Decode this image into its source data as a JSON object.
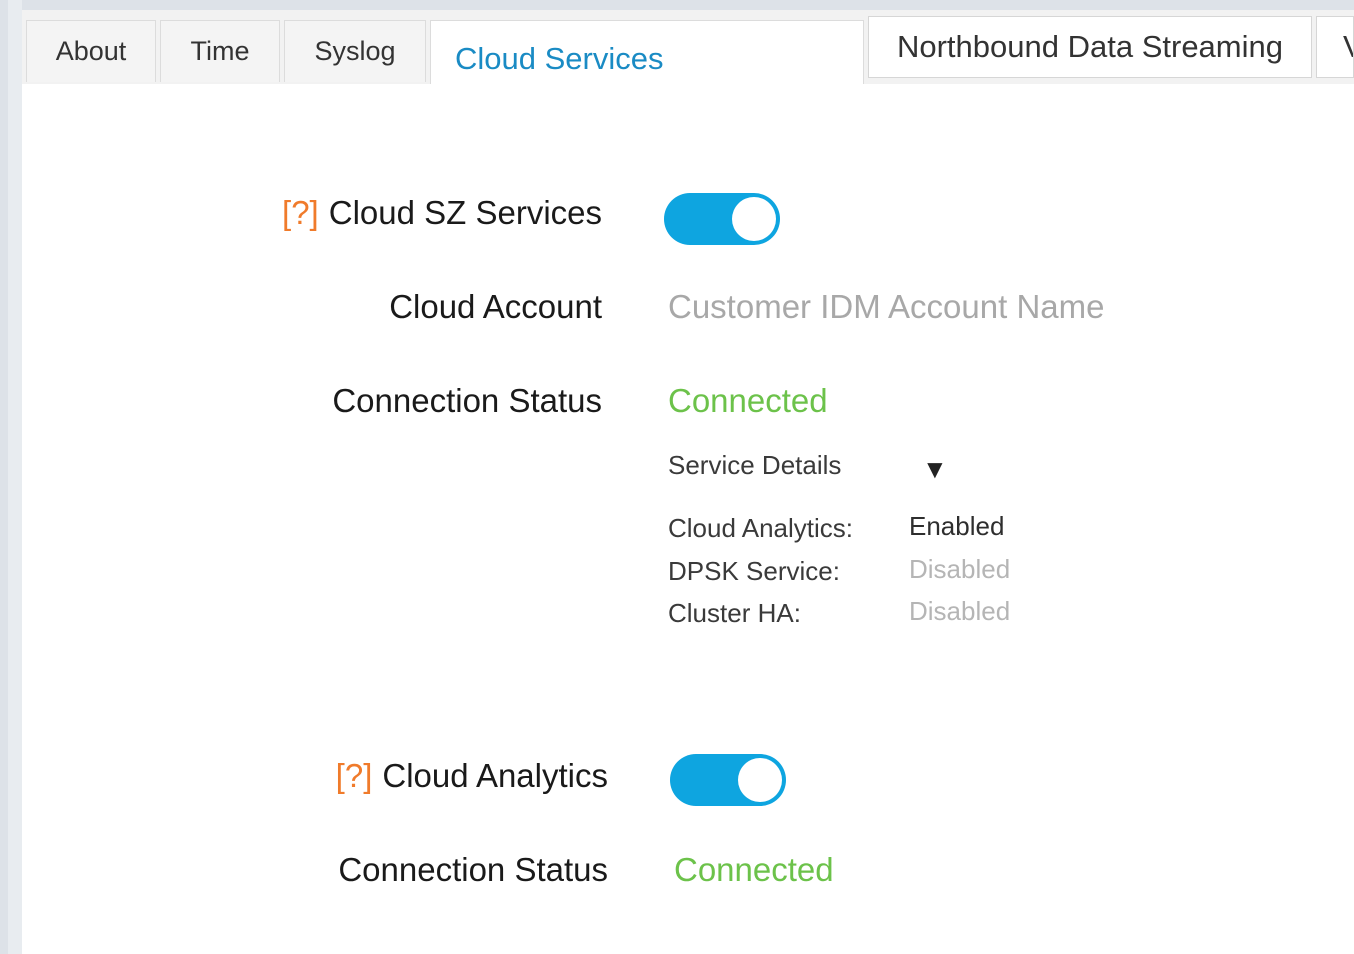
{
  "tabs": [
    {
      "label": "About",
      "active": false
    },
    {
      "label": "Time",
      "active": false
    },
    {
      "label": "Syslog",
      "active": false
    },
    {
      "label": "Cloud Services",
      "active": true
    },
    {
      "label": "Northbound Data Streaming",
      "active": false
    },
    {
      "label": "V",
      "active": false
    }
  ],
  "cloud_sz": {
    "help": "[?]",
    "label": "Cloud SZ Services",
    "toggle_on": true,
    "account_label": "Cloud Account",
    "account_placeholder": "Customer IDM Account Name",
    "status_label": "Connection Status",
    "status_value": "Connected",
    "details_label": "Service Details",
    "details_caret": "▼",
    "details": [
      {
        "name": "Cloud Analytics:",
        "value": "Enabled"
      },
      {
        "name": "DPSK Service:",
        "value": "Disabled"
      },
      {
        "name": "Cluster HA:",
        "value": "Disabled"
      }
    ]
  },
  "cloud_analytics": {
    "help": "[?]",
    "label": "Cloud Analytics",
    "toggle_on": true,
    "status_label": "Connection Status",
    "status_value": "Connected"
  },
  "colors": {
    "accent": "#0ea5e0",
    "connected": "#6cc24a",
    "help": "#f07b2b",
    "active_tab": "#1a8bc4",
    "disabled": "#b5b5b5"
  }
}
